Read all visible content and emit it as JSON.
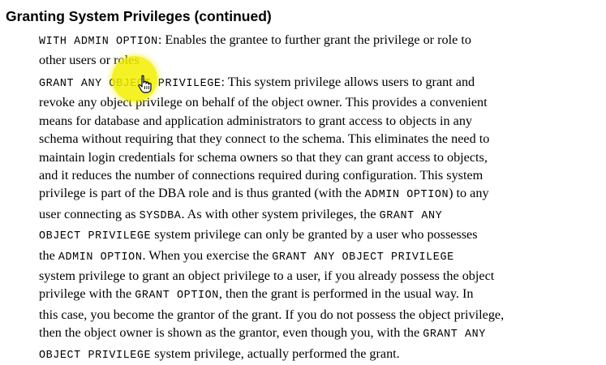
{
  "heading": "Granting System Privileges (continued)",
  "paragraph1": {
    "lines": [
      [
        {
          "t": "WITH ADMIN OPTION",
          "m": true
        },
        {
          "t": ": Enables the grantee to further grant the privilege or role to"
        }
      ],
      [
        {
          "t": "other users or roles"
        }
      ]
    ]
  },
  "paragraph2": {
    "lines": [
      [
        {
          "t": "GRANT ANY OBJECT PRIVILEGE",
          "m": true
        },
        {
          "t": ": This system privilege allows users to grant and"
        }
      ],
      [
        {
          "t": "revoke any object privilege on behalf of the object owner. This provides a convenient"
        }
      ],
      [
        {
          "t": "means for database and application administrators to grant access to objects in any"
        }
      ],
      [
        {
          "t": "schema without requiring that they connect to the schema. This eliminates the need to"
        }
      ],
      [
        {
          "t": "maintain login credentials for schema owners so that they can grant access to objects,"
        }
      ],
      [
        {
          "t": "and it reduces the number of connections required during configuration. This system"
        }
      ],
      [
        {
          "t": "privilege is part of the DBA role and is thus granted (with the "
        },
        {
          "t": "ADMIN OPTION",
          "m": true
        },
        {
          "t": ") to any"
        }
      ],
      [
        {
          "t": "user connecting as "
        },
        {
          "t": "SYSDBA",
          "m": true
        },
        {
          "t": ". As with other system privileges, the "
        },
        {
          "t": "GRANT ANY",
          "m": true
        }
      ],
      [
        {
          "t": "OBJECT PRIVILEGE",
          "m": true
        },
        {
          "t": " system privilege can only be granted by a user who possesses"
        }
      ],
      [
        {
          "t": "the "
        },
        {
          "t": "ADMIN OPTION",
          "m": true
        },
        {
          "t": ". When you exercise the "
        },
        {
          "t": "GRANT ANY OBJECT PRIVILEGE",
          "m": true
        }
      ],
      [
        {
          "t": "system privilege to grant an object privilege to a user, if you already possess the object"
        }
      ],
      [
        {
          "t": "privilege with the "
        },
        {
          "t": "GRANT OPTION",
          "m": true
        },
        {
          "t": ", then the grant is performed in the usual way. In"
        }
      ],
      [
        {
          "t": "this case, you become the grantor of the grant. If you do not possess the object privilege,"
        }
      ],
      [
        {
          "t": "then the object owner is shown as the grantor, even though you, with the "
        },
        {
          "t": "GRANT ANY",
          "m": true
        }
      ],
      [
        {
          "t": "OBJECT PRIVILEGE",
          "m": true
        },
        {
          "t": " system privilege, actually performed the grant."
        }
      ]
    ]
  },
  "colors": {
    "highlight": "#f3f000",
    "text": "#000000"
  },
  "icons": {
    "cursor": "hand-pointer-icon",
    "highlight": "cursor-highlight-circle"
  }
}
